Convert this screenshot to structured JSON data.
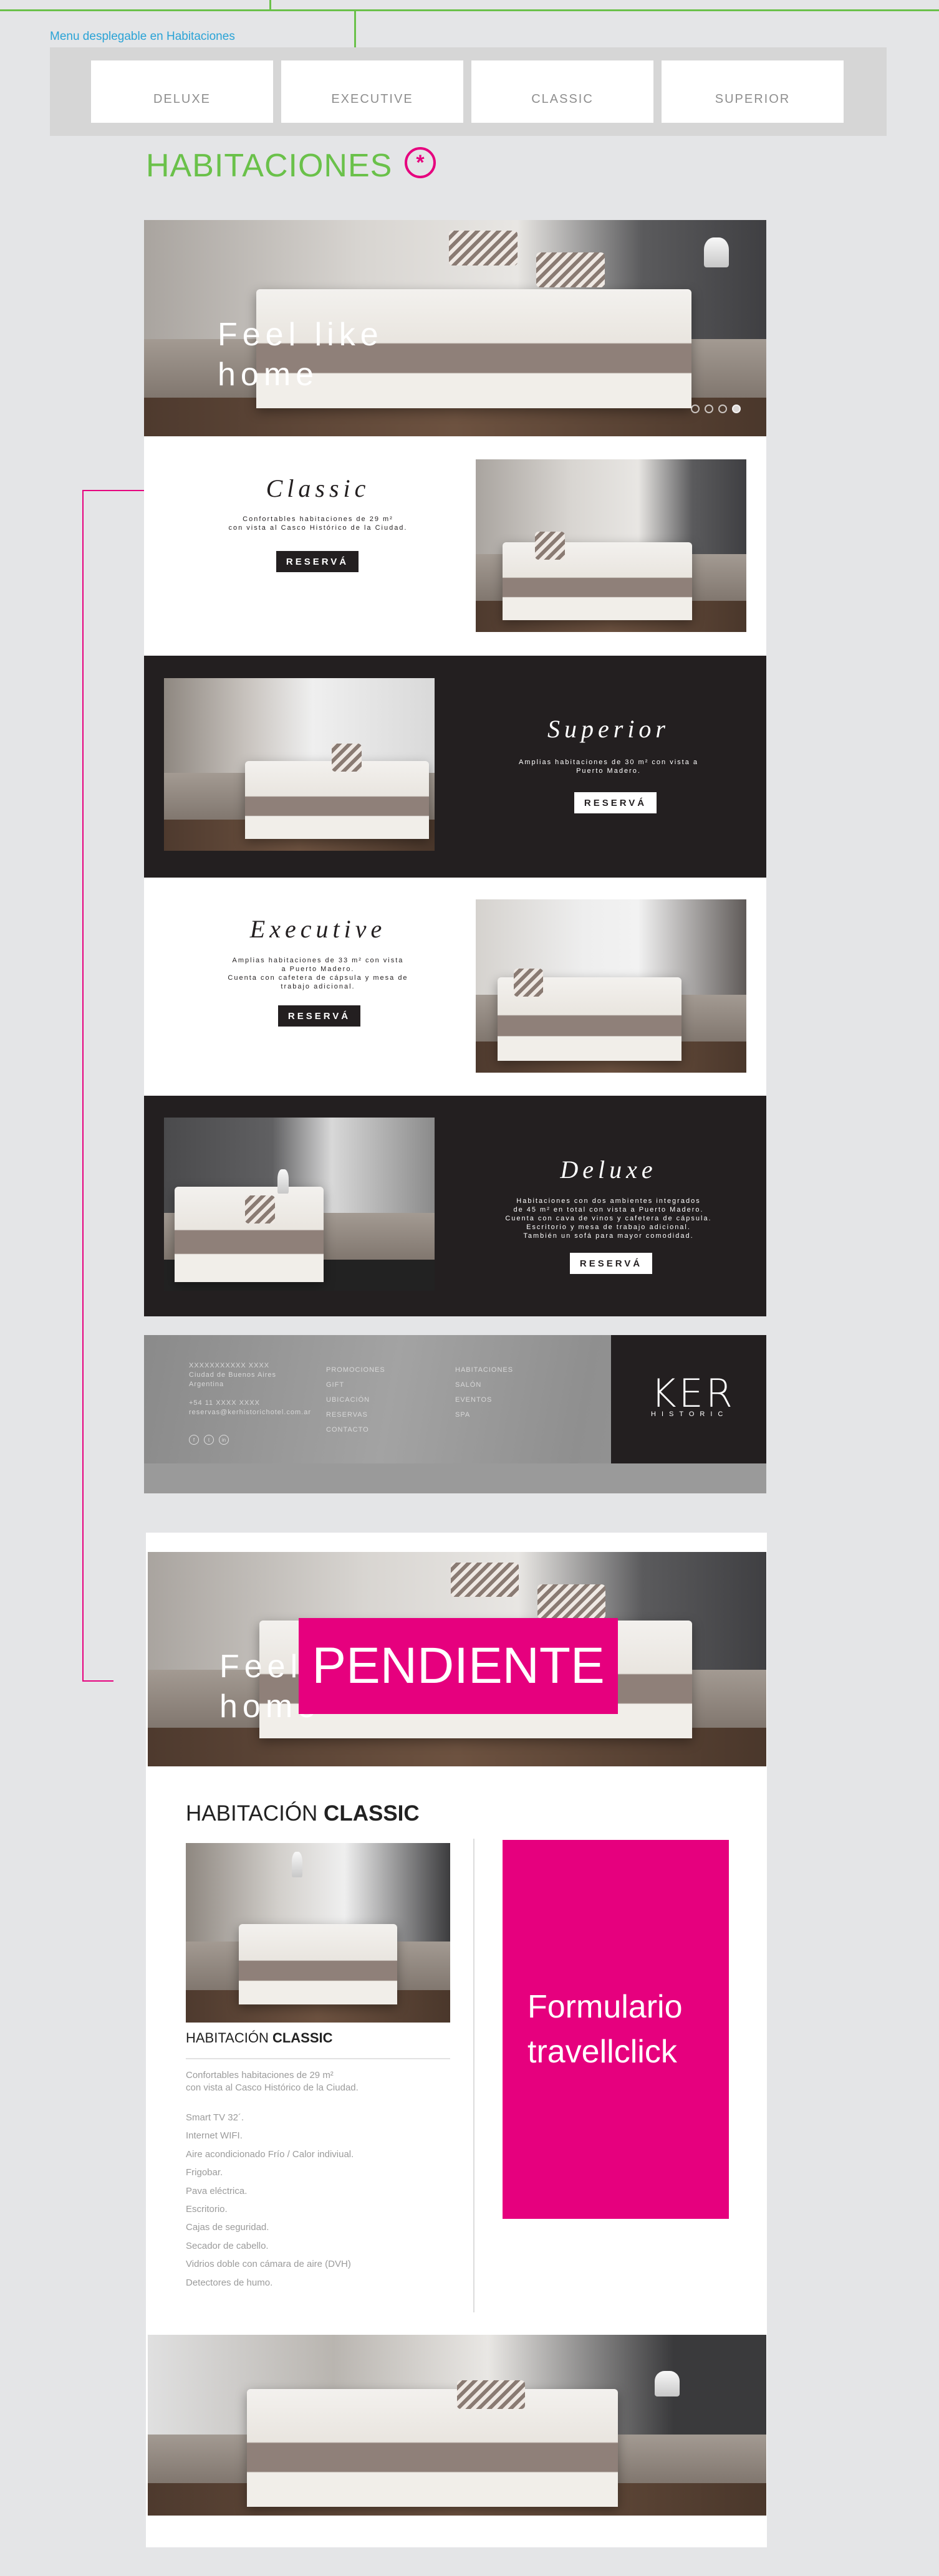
{
  "annotations": {
    "menu_note": "Menu desplegable en  Habitaciones",
    "pendiente": "PENDIENTE",
    "form_placeholder": "Formulario travellclick"
  },
  "menu": {
    "tabs": [
      "DELUXE",
      "EXECUTIVE",
      "CLASSIC",
      "SUPERIOR"
    ]
  },
  "section_title": "HABITACIONES",
  "asterisk": "*",
  "hero": {
    "text_line1": "Feel like",
    "text_line2": "home",
    "slides_total": 4,
    "slide_active": 4
  },
  "rooms": [
    {
      "name": "Classic",
      "desc": "Confortables habitaciones de 29 m²\ncon vista al Casco Histórico de la Ciudad.",
      "button": "RESERVÁ"
    },
    {
      "name": "Superior",
      "desc": "Amplias habitaciones de 30 m² con vista a\nPuerto Madero.",
      "button": "RESERVÁ"
    },
    {
      "name": "Executive",
      "desc": "Amplias habitaciones de 33 m² con vista\na Puerto Madero.\nCuenta con cafetera de cápsula y mesa de\ntrabajo adicional.",
      "button": "RESERVÁ"
    },
    {
      "name": "Deluxe",
      "desc": "Habitaciones con dos ambientes integrados\nde 45 m² en total con vista a Puerto Madero.\nCuenta con cava de vinos y cafetera de cápsula.\nEscritorio y mesa de trabajo adicional.\nTambién un sofá para mayor comodidad.",
      "button": "RESERVÁ"
    }
  ],
  "footer": {
    "contact": [
      "XXXXXXXXXXX XXXX",
      "Ciudad de Buenos Aires",
      "Argentina",
      "",
      "+54 11 XXXX XXXX",
      "reservas@kerhistorichotel.com.ar"
    ],
    "col2": [
      "PROMOCIONES",
      "GIFT",
      "UBICACIÓN",
      "RESERVAS",
      "CONTACTO"
    ],
    "col3": [
      "HABITACIONES",
      "SALÓN",
      "EVENTOS",
      "SPA"
    ],
    "social": [
      "f",
      "t",
      "in"
    ],
    "logo": "KER",
    "logo_sub": "HISTORIC"
  },
  "detail": {
    "hero_text_line1": "Feel like",
    "hero_text_line2": "home",
    "heading_light": "HABITACIÓN ",
    "heading_bold": "CLASSIC",
    "sub_light": "HABITACIÓN ",
    "sub_bold": "CLASSIC",
    "desc": "Confortables habitaciones de 29 m²\ncon vista al Casco Histórico de la Ciudad.",
    "amenities": [
      "Smart TV 32´.",
      "Internet WIFI.",
      "Aire acondicionado Frío / Calor indiviual.",
      "Frigobar.",
      "Pava eléctrica.",
      "Escritorio.",
      "Cajas de seguridad.",
      "Secador de cabello.",
      "Vidrios doble con cámara de aire (DVH)",
      "Detectores de humo."
    ]
  }
}
